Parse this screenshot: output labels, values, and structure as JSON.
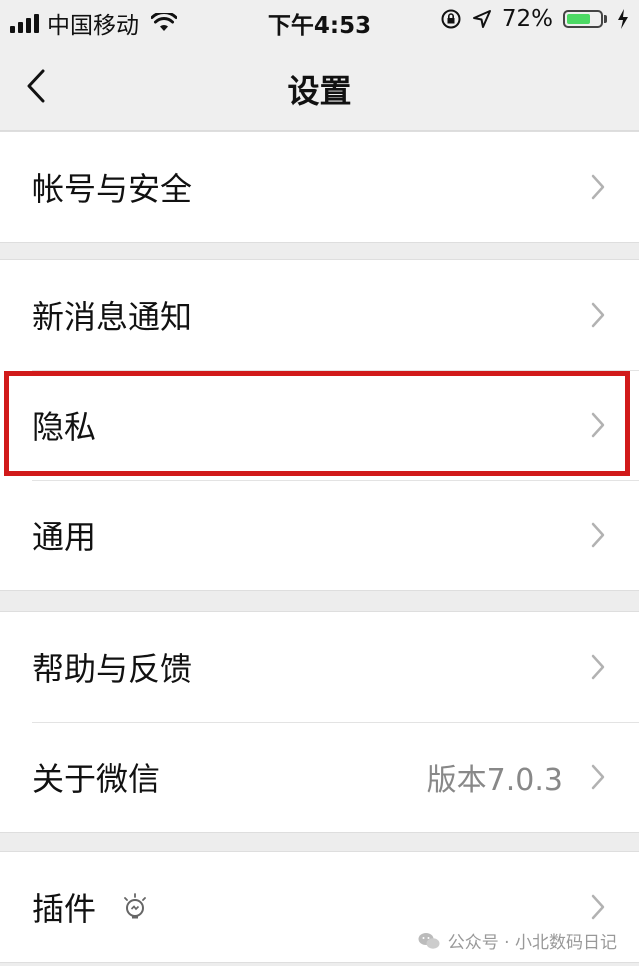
{
  "status_bar": {
    "carrier": "中国移动",
    "time": "下午4:53",
    "battery_percent": "72%",
    "battery_level": 0.72,
    "icons": [
      "signal-icon",
      "wifi-icon",
      "orientation-lock-icon",
      "location-icon",
      "battery-icon",
      "charging-icon"
    ]
  },
  "nav": {
    "title": "设置",
    "back_icon": "chevron-left-icon"
  },
  "groups": [
    {
      "items": [
        {
          "label": "帐号与安全"
        }
      ]
    },
    {
      "items": [
        {
          "label": "新消息通知"
        },
        {
          "label": "隐私"
        },
        {
          "label": "通用"
        }
      ]
    },
    {
      "items": [
        {
          "label": "帮助与反馈"
        },
        {
          "label": "关于微信",
          "value": "版本7.0.3"
        }
      ]
    },
    {
      "items": [
        {
          "label": "插件",
          "icon": "plugin-bulb-icon"
        }
      ]
    }
  ],
  "highlight": {
    "target": "隐私",
    "color": "#d11a1a"
  },
  "watermark": {
    "text": "公众号 · 小北数码日记"
  },
  "colors": {
    "background": "#ededed",
    "accent_battery": "#4cd964",
    "chevron": "#b2b2b2"
  }
}
